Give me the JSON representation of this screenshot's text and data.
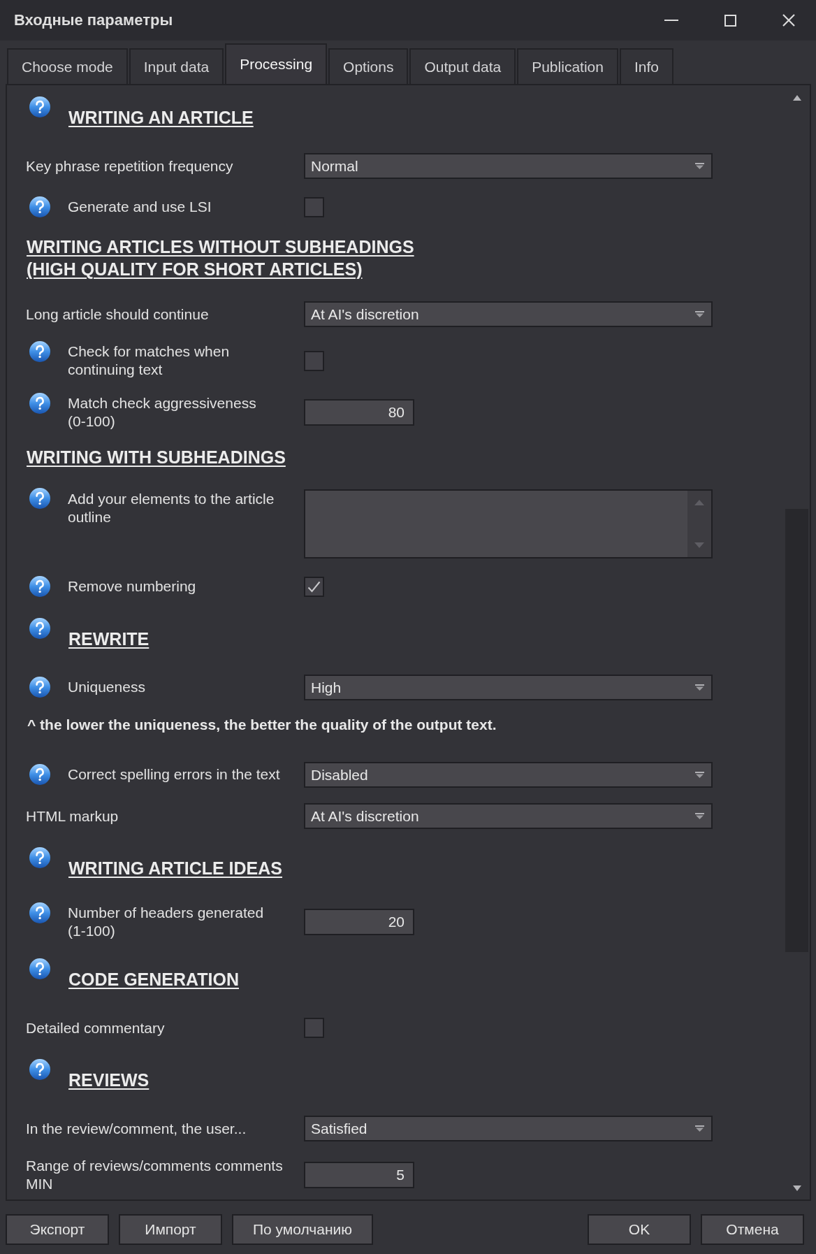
{
  "window": {
    "title": "Входные параметры"
  },
  "tabs": [
    {
      "label": "Choose mode",
      "selected": false
    },
    {
      "label": "Input data",
      "selected": false
    },
    {
      "label": "Processing",
      "selected": true
    },
    {
      "label": "Options",
      "selected": false
    },
    {
      "label": "Output data",
      "selected": false
    },
    {
      "label": "Publication",
      "selected": false
    },
    {
      "label": "Info",
      "selected": false
    }
  ],
  "settings": [
    {
      "kind": "heading",
      "text": "WRITING AN ARTICLE",
      "help": true
    },
    {
      "kind": "select",
      "label": "Key phrase repetition frequency",
      "help": false,
      "value": "Normal"
    },
    {
      "kind": "checkbox",
      "label": "Generate and use LSI",
      "help": true,
      "checked": false
    },
    {
      "kind": "heading",
      "text": "WRITING ARTICLES WITHOUT SUBHEADINGS (HIGH QUALITY FOR SHORT ARTICLES)",
      "help": false
    },
    {
      "kind": "select",
      "label": "Long article should continue",
      "help": false,
      "value": "At AI's discretion"
    },
    {
      "kind": "checkbox",
      "label": "Check for matches when continuing text",
      "help": true,
      "checked": false
    },
    {
      "kind": "number",
      "label": "Match check aggressiveness (0-100)",
      "help": true,
      "value": "80"
    },
    {
      "kind": "heading",
      "text": "WRITING WITH SUBHEADINGS",
      "help": false
    },
    {
      "kind": "textarea",
      "label": "Add your elements to the article outline",
      "help": true
    },
    {
      "kind": "checkbox",
      "label": "Remove numbering",
      "help": true,
      "checked": true
    },
    {
      "kind": "heading",
      "text": "REWRITE",
      "help": true
    },
    {
      "kind": "select",
      "label": "Uniqueness",
      "help": true,
      "value": "High"
    },
    {
      "kind": "note",
      "text": "^ the lower the uniqueness, the better the quality of the output text."
    },
    {
      "kind": "select",
      "label": "Correct spelling errors in the text",
      "help": true,
      "value": "Disabled"
    },
    {
      "kind": "select",
      "label": "HTML markup",
      "help": false,
      "value": "At AI's discretion"
    },
    {
      "kind": "heading",
      "text": "WRITING ARTICLE IDEAS",
      "help": true
    },
    {
      "kind": "number",
      "label": "Number of headers generated (1-100)",
      "help": true,
      "value": "20"
    },
    {
      "kind": "heading",
      "text": "CODE GENERATION",
      "help": true
    },
    {
      "kind": "checkbox",
      "label": "Detailed commentary",
      "help": false,
      "checked": false
    },
    {
      "kind": "heading",
      "text": "REVIEWS",
      "help": true
    },
    {
      "kind": "select",
      "label": "In the review/comment, the user...",
      "help": false,
      "value": "Satisfied"
    },
    {
      "kind": "number",
      "label": "Range of reviews/comments comments MIN",
      "help": false,
      "value": "5"
    }
  ],
  "footer_left_buttons": [
    "Экспорт",
    "Импорт",
    "По умолчанию"
  ],
  "footer_right_buttons": [
    "OK",
    "Отмена"
  ]
}
